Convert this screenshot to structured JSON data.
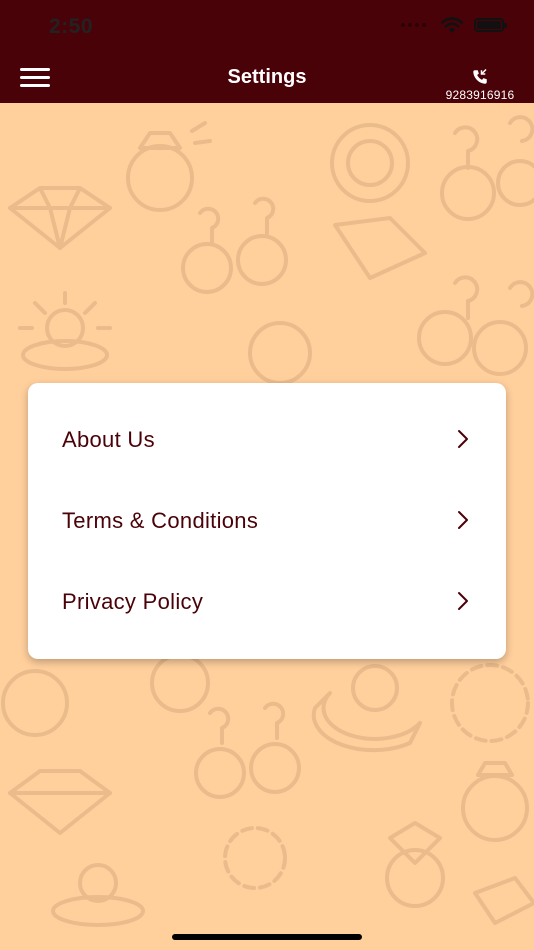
{
  "status_bar": {
    "time": "2:50"
  },
  "nav": {
    "title": "Settings",
    "phone_number": "9283916916"
  },
  "settings": {
    "items": [
      {
        "label": "About Us"
      },
      {
        "label": "Terms & Conditions"
      },
      {
        "label": "Privacy Policy"
      }
    ]
  },
  "colors": {
    "primary": "#4A0209",
    "background": "#FFCF9C",
    "card": "#FFFFFF",
    "pattern": "#E9B98A"
  },
  "icons": {
    "menu": "hamburger-icon",
    "phone": "phone-icon",
    "chevron": "chevron-right-icon"
  }
}
